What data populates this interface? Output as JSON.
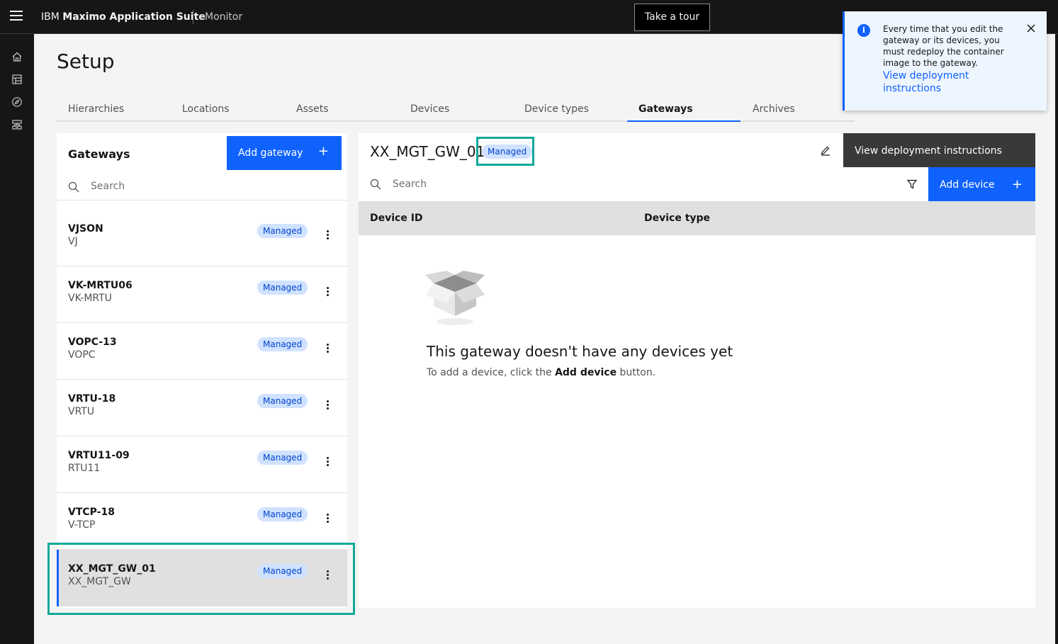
{
  "header": {
    "brand_prefix": "IBM",
    "brand_name": "Maximo Application Suite",
    "app_name": "Monitor",
    "tour_label": "Take a tour"
  },
  "rail": {
    "icons": [
      "home-icon",
      "dashboard-icon",
      "compass-icon",
      "setup-icon"
    ]
  },
  "page": {
    "title": "Setup"
  },
  "tabs": [
    {
      "label": "Hierarchies",
      "active": false
    },
    {
      "label": "Locations",
      "active": false
    },
    {
      "label": "Assets",
      "active": false
    },
    {
      "label": "Devices",
      "active": false
    },
    {
      "label": "Device types",
      "active": false
    },
    {
      "label": "Gateways",
      "active": true
    },
    {
      "label": "Archives",
      "active": false
    }
  ],
  "gateways_panel": {
    "title": "Gateways",
    "add_label": "Add gateway",
    "search_placeholder": "Search",
    "items": [
      {
        "name": "VJSON",
        "type": "VJ",
        "status": "Managed",
        "selected": false
      },
      {
        "name": "VK-MRTU06",
        "type": "VK-MRTU",
        "status": "Managed",
        "selected": false
      },
      {
        "name": "VOPC-13",
        "type": "VOPC",
        "status": "Managed",
        "selected": false
      },
      {
        "name": "VRTU-18",
        "type": "VRTU",
        "status": "Managed",
        "selected": false
      },
      {
        "name": "VRTU11-09",
        "type": "RTU11",
        "status": "Managed",
        "selected": false
      },
      {
        "name": "VTCP-18",
        "type": "V-TCP",
        "status": "Managed",
        "selected": false
      },
      {
        "name": "XX_MGT_GW_01",
        "type": "XX_MGT_GW",
        "status": "Managed",
        "selected": true
      }
    ]
  },
  "detail": {
    "title": "XX_MGT_GW_01",
    "status": "Managed",
    "deploy_label": "View deployment instructions",
    "search_placeholder": "Search",
    "add_device_label": "Add device",
    "columns": [
      "Device ID",
      "Device type"
    ],
    "empty_title": "This gateway doesn't have any devices yet",
    "empty_msg_before": "To add a device, click the ",
    "empty_msg_bold": "Add device",
    "empty_msg_after": " button."
  },
  "notification": {
    "text": "Every time that you edit the gateway or its devices, you must redeploy the container image to the gateway.",
    "link": "View deployment instructions"
  },
  "colors": {
    "primary": "#0f62fe",
    "tag_bg": "#d0e2ff",
    "highlight": "#12a89a"
  }
}
